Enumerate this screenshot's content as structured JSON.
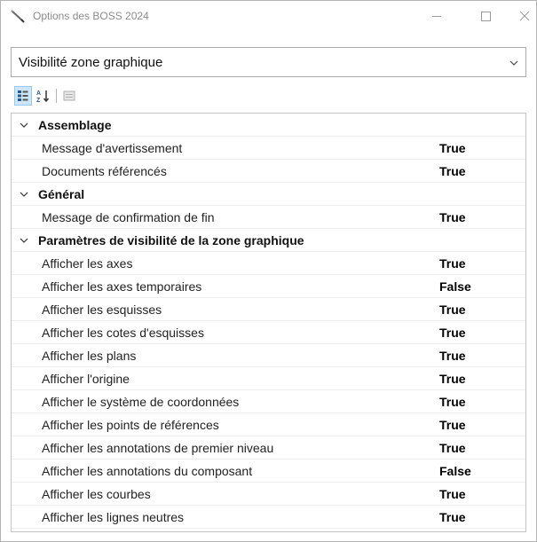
{
  "window": {
    "title": "Options des BOSS 2024",
    "icon": "pencil-icon"
  },
  "dropdown": {
    "selected": "Visibilité zone graphique"
  },
  "toolbar": {
    "buttons": [
      "categorized-view-icon",
      "alphabetical-sort-icon",
      "property-pages-icon"
    ]
  },
  "categories": [
    {
      "label": "Assemblage",
      "properties": [
        {
          "name": "Message d'avertissement",
          "value": "True"
        },
        {
          "name": "Documents référencés",
          "value": "True"
        }
      ]
    },
    {
      "label": "Général",
      "properties": [
        {
          "name": "Message de confirmation de fin",
          "value": "True"
        }
      ]
    },
    {
      "label": "Paramètres de visibilité de la zone graphique",
      "properties": [
        {
          "name": "Afficher les axes",
          "value": "True"
        },
        {
          "name": "Afficher les axes temporaires",
          "value": "False"
        },
        {
          "name": "Afficher les esquisses",
          "value": "True"
        },
        {
          "name": "Afficher les cotes d'esquisses",
          "value": "True"
        },
        {
          "name": "Afficher les plans",
          "value": "True"
        },
        {
          "name": "Afficher l'origine",
          "value": "True"
        },
        {
          "name": "Afficher le système de coordonnées",
          "value": "True"
        },
        {
          "name": "Afficher les points de références",
          "value": "True"
        },
        {
          "name": "Afficher les annotations de premier niveau",
          "value": "True"
        },
        {
          "name": "Afficher les annotations du composant",
          "value": "False"
        },
        {
          "name": "Afficher les courbes",
          "value": "True"
        },
        {
          "name": "Afficher les lignes neutres",
          "value": "True"
        }
      ]
    }
  ]
}
